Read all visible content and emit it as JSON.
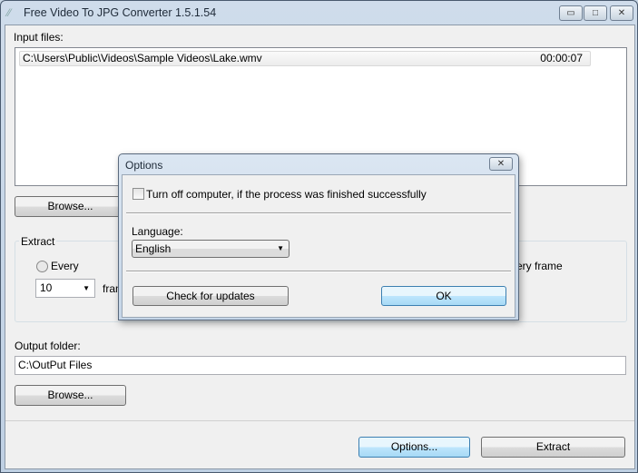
{
  "window": {
    "title": "Free Video To JPG Converter 1.5.1.54"
  },
  "input": {
    "label": "Input files:",
    "files": [
      {
        "path": "C:\\Users\\Public\\Videos\\Sample Videos\\Lake.wmv",
        "duration": "00:00:07"
      }
    ],
    "browse": "Browse..."
  },
  "extract": {
    "label": "Extract",
    "every": "Every",
    "every_value": "10",
    "frames": "frames",
    "every_frame": "Every frame"
  },
  "output": {
    "label": "Output folder:",
    "path": "C:\\OutPut Files",
    "browse": "Browse..."
  },
  "footer": {
    "options": "Options...",
    "extract": "Extract"
  },
  "dialog": {
    "title": "Options",
    "shutdown": "Turn off computer, if the process was finished successfully",
    "shutdown_checked": false,
    "language_label": "Language:",
    "language": "English",
    "check_updates": "Check for updates",
    "ok": "OK"
  }
}
